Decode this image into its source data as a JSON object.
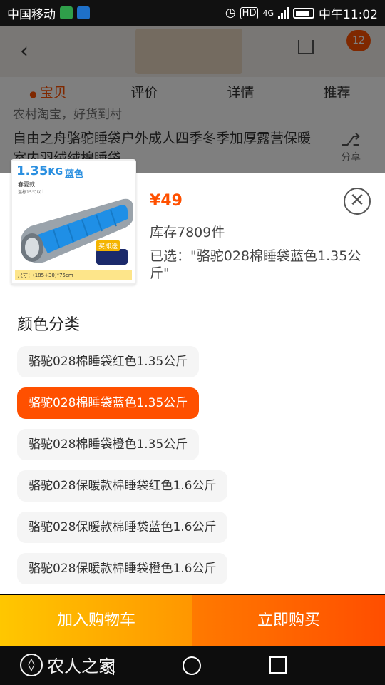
{
  "status_bar": {
    "carrier": "中国移动",
    "hd_label": "HD",
    "net_label": "4G",
    "time": "中午11:02"
  },
  "product_page": {
    "cart_count": "12",
    "tabs": [
      "宝贝",
      "评价",
      "详情",
      "推荐"
    ],
    "active_tab": "宝贝",
    "slogan": "农村淘宝，好货到村",
    "title": "自由之舟骆驼睡袋户外成人四季冬季加厚露营保暖室内羽绒绒棉睡袋",
    "share_label": "分享"
  },
  "sku_sheet": {
    "thumbnail": {
      "weight": "1.35",
      "weight_unit": "KG",
      "color": "蓝色",
      "season": "春夏款",
      "temp": "温标15℃以上",
      "promo": "买即送",
      "size": "尺寸：(185+30)*75cm"
    },
    "price": "¥49",
    "stock": "库存7809件",
    "selected": "已选：\"骆驼028棉睡袋蓝色1.35公斤\"",
    "section_title": "颜色分类",
    "options": [
      "骆驼028棉睡袋红色1.35公斤",
      "骆驼028棉睡袋蓝色1.35公斤",
      "骆驼028棉睡袋橙色1.35公斤",
      "骆驼028保暖款棉睡袋红色1.6公斤",
      "骆驼028保暖款棉睡袋蓝色1.6公斤",
      "骆驼028保暖款棉睡袋橙色1.6公斤"
    ],
    "selected_index": 1
  },
  "actions": {
    "add_to_cart": "加入购物车",
    "buy_now": "立即购买"
  },
  "watermark": "农人之家",
  "colors": {
    "accent": "#ff5000",
    "cart_button": "#ffb300",
    "buy_button": "#ff5a00"
  }
}
